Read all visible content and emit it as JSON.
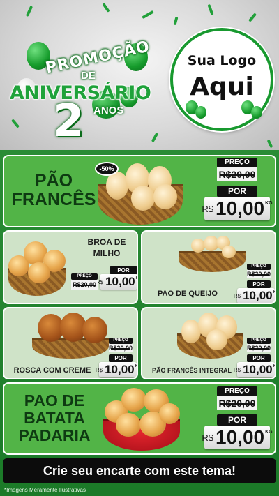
{
  "header": {
    "promo_word": "PROMOÇÃO",
    "de_word": "DE",
    "aniversario_word": "ANIVERSÁRIO",
    "years_number": "2",
    "anos_word": "ANOS",
    "logo_line1": "Sua Logo",
    "logo_line2": "Aqui"
  },
  "featured_top": {
    "name_line1": "PÃO",
    "name_line2": "FRANCÊS",
    "discount": "-50%",
    "preco_label": "PREÇO",
    "old_price": "R$20,00",
    "por_label": "POR",
    "currency": "R$",
    "new_price": "10,00",
    "unit": "KG"
  },
  "grid_items": [
    {
      "name": "BROA DE MILHO",
      "preco_label": "PREÇO",
      "old_price": "R$20,00",
      "por_label": "POR",
      "currency": "R$",
      "new_price": "10,00",
      "unit": "KG"
    },
    {
      "name": "PAO DE QUEIJO",
      "preco_label": "PREÇO",
      "old_price": "R$20,00",
      "por_label": "POR",
      "currency": "R$",
      "new_price": "10,00",
      "unit": "KG"
    },
    {
      "name": "ROSCA COM CREME",
      "preco_label": "PREÇO",
      "old_price": "R$20,00",
      "por_label": "POR",
      "currency": "R$",
      "new_price": "10,00",
      "unit": "KG"
    },
    {
      "name": "PÃO FRANCÊS INTEGRAL",
      "preco_label": "PREÇO",
      "old_price": "R$20,00",
      "por_label": "POR",
      "currency": "R$",
      "new_price": "10,00",
      "unit": "KG"
    }
  ],
  "featured_bottom": {
    "name_line1": "PAO DE",
    "name_line2": "BATATA",
    "name_line3": "PADARIA",
    "preco_label": "PREÇO",
    "old_price": "R$20,00",
    "por_label": "POR",
    "currency": "R$",
    "new_price": "10,00",
    "unit": "KG"
  },
  "cta_text": "Crie seu encarte com este tema!",
  "footer_note": "*Imagens Meramente Ilustrativas",
  "colors": {
    "brand_green": "#1fa23a",
    "card_green": "#52b447",
    "card_light": "#cfe3c8",
    "dark": "#111111"
  }
}
